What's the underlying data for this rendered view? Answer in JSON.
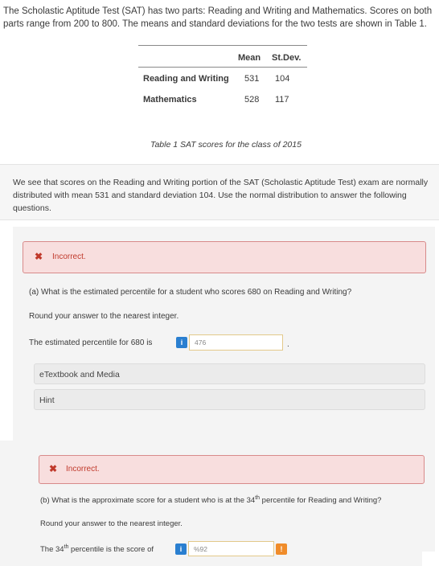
{
  "intro": {
    "text": "The Scholastic Aptitude Test (SAT) has two parts: Reading and Writing and Mathematics. Scores on both parts range from 200 to 800. The means and standard deviations for the two tests are shown in Table 1."
  },
  "table": {
    "headers": [
      "",
      "Mean",
      "St.Dev."
    ],
    "rows": [
      {
        "label": "Reading and Writing",
        "mean": "531",
        "sd": "104"
      },
      {
        "label": "Mathematics",
        "mean": "528",
        "sd": "117"
      }
    ],
    "caption": "Table 1 SAT scores for the class of 2015"
  },
  "context": {
    "text": "We see that scores on the Reading and Writing portion of the SAT (Scholastic Aptitude Test) exam are normally distributed with mean 531 and standard deviation 104. Use the normal distribution to answer the following questions."
  },
  "part_a": {
    "status": "Incorrect.",
    "question": "(a) What is the estimated percentile for a student who scores 680 on Reading and Writing?",
    "instruction": "Round your answer to the nearest integer.",
    "answer_prefix": "The estimated percentile for 680 is",
    "answer_value": "476",
    "answer_suffix": ".",
    "info_icon_text": "i",
    "ebook_label": "eTextbook and Media",
    "hint_label": "Hint"
  },
  "part_b": {
    "status": "Incorrect.",
    "question_pre": "(b) What is the approximate score for a student who is at the 34",
    "question_sup": "th",
    "question_post": " percentile for Reading and Writing?",
    "instruction": "Round your answer to the nearest integer.",
    "answer_pre": "The 34",
    "answer_sup": "th",
    "answer_post": " percentile is the score of",
    "answer_value": "%92",
    "info_icon_text": "i",
    "warn_icon_text": "!"
  },
  "colors": {
    "incorrect_bg": "#f8dede",
    "incorrect_border": "#d88a8a",
    "incorrect_text": "#c0392b",
    "info_blue": "#2a7fd0",
    "answer_border": "#e3c98a",
    "warn_orange": "#f08c2a"
  }
}
